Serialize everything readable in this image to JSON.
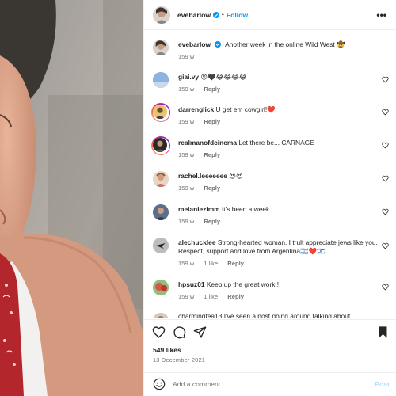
{
  "post": {
    "username": "evebarlow",
    "follow_label": "Follow",
    "separator": "•",
    "more_label": "•••"
  },
  "caption": {
    "username": "evebarlow",
    "text": "Another week in the online Wild West 🤠",
    "time": "159 w"
  },
  "comments": [
    {
      "username": "giai.vy",
      "text": "😠🖤😂😂😂😂",
      "time": "159 w",
      "likes": "",
      "reply": "Reply"
    },
    {
      "username": "darrenglick",
      "text": "U get em cowgirl!❤️",
      "time": "159 w",
      "likes": "",
      "reply": "Reply"
    },
    {
      "username": "realmanofdcinema",
      "text": "Let there be... CARNAGE",
      "time": "159 w",
      "likes": "",
      "reply": "Reply"
    },
    {
      "username": "rachel.leeeeeee",
      "text": "😍😍",
      "time": "159 w",
      "likes": "",
      "reply": "Reply"
    },
    {
      "username": "melaniezimm",
      "text": "It's been a week.",
      "time": "159 w",
      "likes": "",
      "reply": "Reply"
    },
    {
      "username": "alechucklee",
      "text": "Strong-hearted woman. I trult appreciate jews like you. Respect, support and love from Argentina🇦🇷❤️🇮🇱",
      "time": "159 w",
      "likes": "1 like",
      "reply": "Reply"
    },
    {
      "username": "hpsuz01",
      "text": "Keep up the great work!!",
      "time": "159 w",
      "likes": "1 like",
      "reply": "Reply"
    },
    {
      "username": "charmingtea13",
      "text": "I've seen a post going around talking about",
      "time": "",
      "likes": "",
      "reply": ""
    }
  ],
  "engagement": {
    "likes": "549 likes",
    "date": "13 December 2021"
  },
  "composer": {
    "placeholder": "Add a comment...",
    "post_label": "Post"
  },
  "icons": {
    "like": "heart-icon",
    "comment": "comment-icon",
    "share": "paper-plane-icon",
    "save": "bookmark-icon",
    "emoji": "smiley-icon"
  },
  "colors": {
    "link_blue": "#0095f6",
    "post_disabled": "#b2dffc",
    "muted": "#737373",
    "verified": "#0095f6"
  }
}
